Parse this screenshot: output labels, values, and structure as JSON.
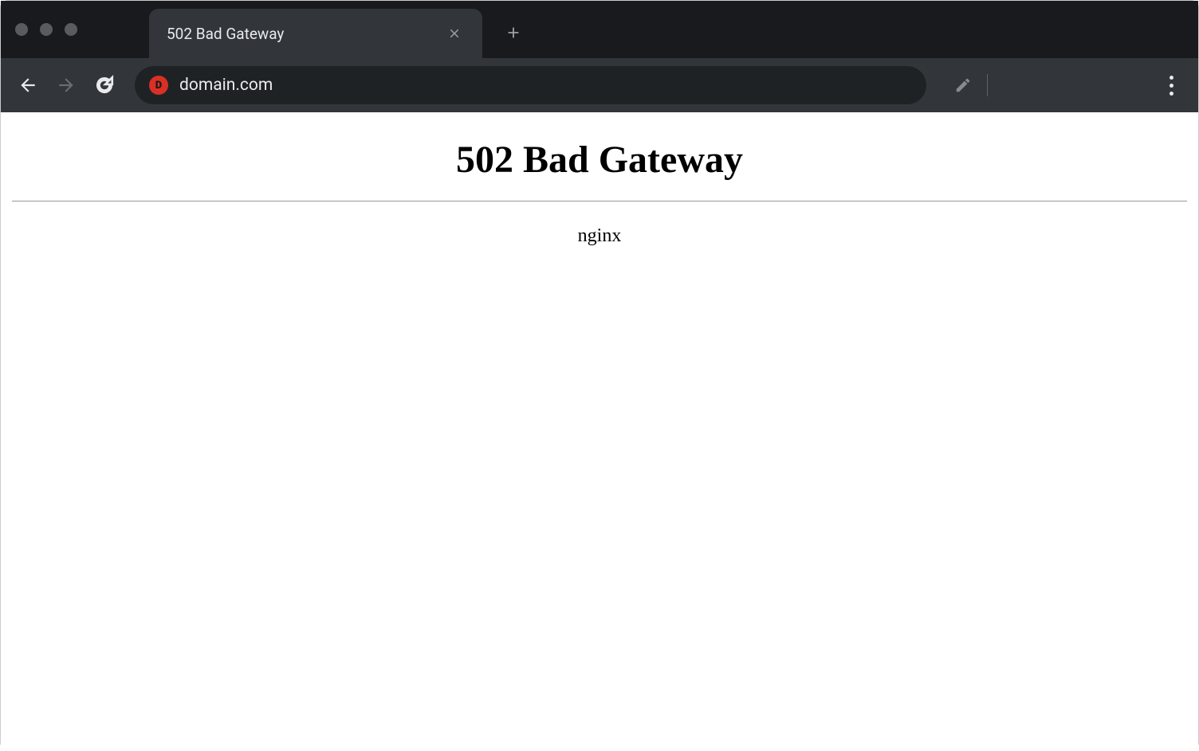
{
  "browser": {
    "tab": {
      "title": "502 Bad Gateway"
    },
    "url": "domain.com"
  },
  "page": {
    "heading": "502 Bad Gateway",
    "server": "nginx"
  }
}
